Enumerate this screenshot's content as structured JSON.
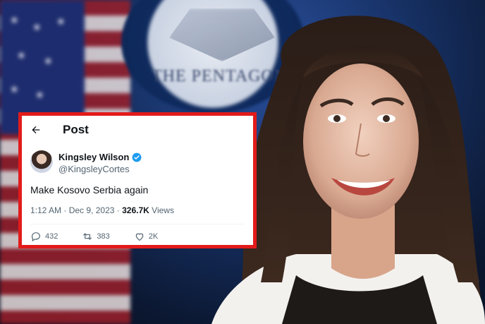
{
  "tweet": {
    "header_title": "Post",
    "author_name": "Kingsley Wilson",
    "author_handle": "@KingsleyCortes",
    "text": "Make Kosovo Serbia again",
    "time": "1:12 AM",
    "separator": "·",
    "date": "Dec 9, 2023",
    "view_count": "326.7K",
    "views_label": "Views",
    "replies": "432",
    "reposts": "383",
    "likes": "2K",
    "icons": {
      "back": "arrow-left-icon",
      "verified": "verified-badge-icon",
      "reply": "reply-icon",
      "repost": "repost-icon",
      "like": "heart-icon"
    }
  },
  "background": {
    "seal_text": "THE PENTAGON"
  },
  "colors": {
    "highlight_border": "#e21b1b",
    "verified_blue": "#1d9bf0",
    "text_secondary": "#536471"
  }
}
